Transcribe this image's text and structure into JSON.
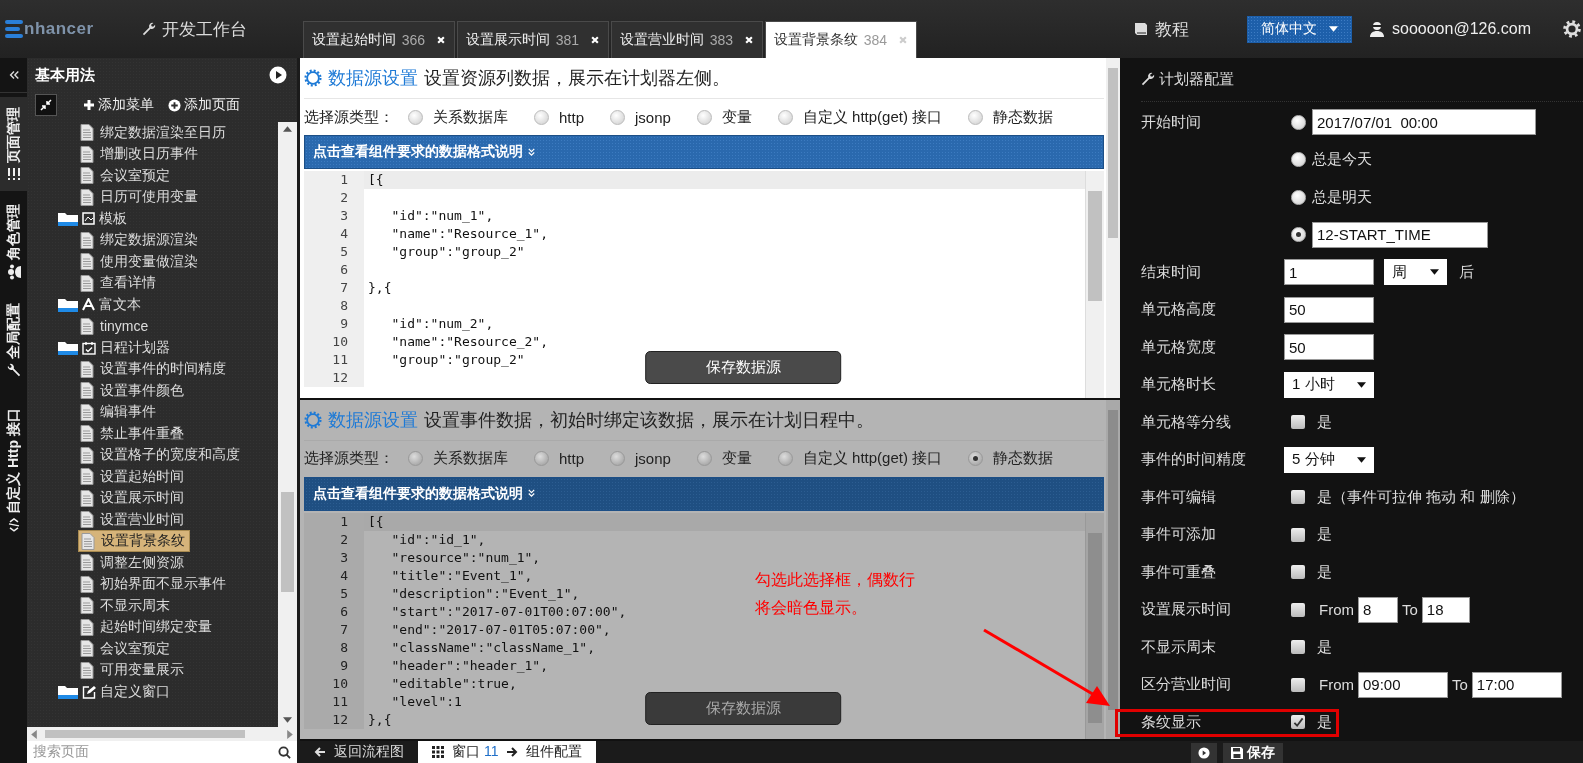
{
  "topbar": {
    "logo": "nhancer",
    "workbench": "开发工作台",
    "tabs": [
      {
        "label": "设置起始时间",
        "count": "366",
        "selected": false
      },
      {
        "label": "设置展示时间",
        "count": "381",
        "selected": false
      },
      {
        "label": "设置营业时间",
        "count": "383",
        "selected": false
      },
      {
        "label": "设置背景条纹",
        "count": "384",
        "selected": true
      }
    ],
    "tutorial": "教程",
    "language": "简体中文",
    "user": "sooooon@126.com"
  },
  "nav_tabs": [
    {
      "label": "页面管理",
      "selected": true
    },
    {
      "label": "角色管理",
      "selected": false
    },
    {
      "label": "全局配置",
      "selected": false
    },
    {
      "label": "自定义 Http 接口",
      "selected": false
    }
  ],
  "sidebar": {
    "title": "基本用法",
    "actions": [
      "添加菜单",
      "添加页面"
    ],
    "tree": [
      {
        "kind": "group",
        "children": [
          {
            "kind": "page",
            "label": "绑定数据渲染至日历",
            "selected": false
          },
          {
            "kind": "page",
            "label": "增删改日历事件",
            "selected": false
          },
          {
            "kind": "page",
            "label": "会议室预定",
            "selected": false
          },
          {
            "kind": "page",
            "label": "日历可使用变量",
            "selected": false
          }
        ]
      },
      {
        "kind": "folder",
        "label": "模板",
        "children": [
          {
            "kind": "page",
            "label": "绑定数据源渲染",
            "selected": false
          },
          {
            "kind": "page",
            "label": "使用变量做渲染",
            "selected": false
          },
          {
            "kind": "page",
            "label": "查看详情",
            "selected": false
          }
        ]
      },
      {
        "kind": "folder",
        "label": "富文本",
        "children": [
          {
            "kind": "page",
            "label": "tinymce",
            "selected": false
          }
        ]
      },
      {
        "kind": "folder",
        "label": "日程计划器",
        "children": [
          {
            "kind": "page",
            "label": "设置事件的时间精度",
            "selected": false
          },
          {
            "kind": "page",
            "label": "设置事件颜色",
            "selected": false
          },
          {
            "kind": "page",
            "label": "编辑事件",
            "selected": false
          },
          {
            "kind": "page",
            "label": "禁止事件重叠",
            "selected": false
          },
          {
            "kind": "page",
            "label": "设置格子的宽度和高度",
            "selected": false
          },
          {
            "kind": "page",
            "label": "设置起始时间",
            "selected": false
          },
          {
            "kind": "page",
            "label": "设置展示时间",
            "selected": false
          },
          {
            "kind": "page",
            "label": "设置营业时间",
            "selected": false
          },
          {
            "kind": "page",
            "label": "设置背景条纹",
            "selected": true
          },
          {
            "kind": "page",
            "label": "调整左侧资源",
            "selected": false
          },
          {
            "kind": "page",
            "label": "初始界面不显示事件",
            "selected": false
          },
          {
            "kind": "page",
            "label": "不显示周末",
            "selected": false
          },
          {
            "kind": "page",
            "label": "起始时间绑定变量",
            "selected": false
          },
          {
            "kind": "page",
            "label": "会议室预定",
            "selected": false
          },
          {
            "kind": "page",
            "label": "可用变量展示",
            "selected": false
          }
        ]
      },
      {
        "kind": "folder",
        "label": "自定义窗口"
      }
    ],
    "search": {
      "placeholder": "搜索页面"
    }
  },
  "panels": [
    {
      "heading": "数据源设置",
      "description": "设置资源列数据，展示在计划器左侧。",
      "dimmed": false,
      "source_label": "选择源类型：",
      "sources": [
        {
          "label": "关系数据库",
          "selected": false
        },
        {
          "label": "http",
          "selected": false
        },
        {
          "label": "jsonp",
          "selected": false
        },
        {
          "label": "变量",
          "selected": false
        },
        {
          "label": "自定义 http(get) 接口",
          "selected": false
        },
        {
          "label": "静态数据",
          "selected": false
        }
      ],
      "format_hint": "点击查看组件要求的数据格式说明",
      "code_lines": [
        {
          "number": "1",
          "code": "[{"
        },
        {
          "number": "2"
        },
        {
          "number": "3",
          "code": "   \"id\":\"num_1\","
        },
        {
          "number": "4",
          "code": "   \"name\":\"Resource_1\","
        },
        {
          "number": "5",
          "code": "   \"group\":\"group_2\""
        },
        {
          "number": "6"
        },
        {
          "number": "7",
          "code": "},{"
        },
        {
          "number": "8"
        },
        {
          "number": "9",
          "code": "   \"id\":\"num_2\","
        },
        {
          "number": "10",
          "code": "   \"name\":\"Resource_2\","
        },
        {
          "number": "11",
          "code": "   \"group\":\"group_2\""
        },
        {
          "number": "12"
        }
      ],
      "save": "保存数据源"
    },
    {
      "heading": "数据源设置",
      "description": "设置事件数据，初始时绑定该数据，展示在计划日程中。",
      "dimmed": true,
      "source_label": "选择源类型：",
      "sources": [
        {
          "label": "关系数据库",
          "selected": false
        },
        {
          "label": "http",
          "selected": false
        },
        {
          "label": "jsonp",
          "selected": false
        },
        {
          "label": "变量",
          "selected": false
        },
        {
          "label": "自定义 http(get) 接口",
          "selected": false
        },
        {
          "label": "静态数据",
          "selected": true
        }
      ],
      "format_hint": "点击查看组件要求的数据格式说明",
      "code_lines": [
        {
          "number": "1",
          "code": "[{"
        },
        {
          "number": "2",
          "code": "   \"id\":\"id_1\","
        },
        {
          "number": "3",
          "code": "   \"resource\":\"num_1\","
        },
        {
          "number": "4",
          "code": "   \"title\":\"Event_1\","
        },
        {
          "number": "5",
          "code": "   \"description\":\"Event_1\","
        },
        {
          "number": "6",
          "code": "   \"start\":\"2017-07-01T00:07:00\","
        },
        {
          "number": "7",
          "code": "   \"end\":\"2017-07-01T05:07:00\","
        },
        {
          "number": "8",
          "code": "   \"className\":\"className_1\","
        },
        {
          "number": "9",
          "code": "   \"header\":\"header_1\","
        },
        {
          "number": "10",
          "code": "   \"editable\":true,"
        },
        {
          "number": "11",
          "code": "   \"level\":1"
        },
        {
          "number": "12",
          "code": "},{"
        }
      ],
      "save": "保存数据源"
    }
  ],
  "annotation": {
    "text": "勾选此选择框，偶数行将会暗色显示。"
  },
  "config": {
    "title": "计划器配置",
    "rows": [
      {
        "kind": "start",
        "label": "开始时间",
        "highlighted": false,
        "options": [
          {
            "selected": false,
            "value": "2017/07/01  00:00"
          },
          {
            "selected": false,
            "text": "总是今天"
          },
          {
            "selected": false,
            "text": "总是明天"
          },
          {
            "selected": true,
            "value": "12-START_TIME"
          }
        ]
      },
      {
        "kind": "duration",
        "label": "结束时间",
        "highlighted": false,
        "value": "1",
        "unit": "周",
        "suffix": "后"
      },
      {
        "kind": "input",
        "label": "单元格高度",
        "highlighted": false,
        "value": "50"
      },
      {
        "kind": "input",
        "label": "单元格宽度",
        "highlighted": false,
        "value": "50"
      },
      {
        "kind": "select",
        "label": "单元格时长",
        "highlighted": false,
        "value": "1 小时"
      },
      {
        "kind": "checkbox",
        "label": "单元格等分线",
        "highlighted": false,
        "checked": false,
        "text": "是"
      },
      {
        "kind": "select",
        "label": "事件的时间精度",
        "highlighted": false,
        "value": "5 分钟"
      },
      {
        "kind": "checkbox",
        "label": "事件可编辑",
        "highlighted": false,
        "checked": false,
        "text": "是（事件可拉伸 拖动 和 删除）"
      },
      {
        "kind": "checkbox",
        "label": "事件可添加",
        "highlighted": false,
        "checked": false,
        "text": "是"
      },
      {
        "kind": "checkbox",
        "label": "事件可重叠",
        "highlighted": false,
        "checked": false,
        "text": "是"
      },
      {
        "kind": "range",
        "label": "设置展示时间",
        "highlighted": false,
        "checked": false,
        "from_label": "From",
        "from": "8",
        "to_label": "To",
        "to": "18"
      },
      {
        "kind": "checkbox",
        "label": "不显示周末",
        "highlighted": false,
        "checked": false,
        "text": "是"
      },
      {
        "kind": "range",
        "label": "区分营业时间",
        "highlighted": false,
        "checked": false,
        "from_label": "From",
        "from": "09:00",
        "to_label": "To",
        "to": "17:00"
      },
      {
        "kind": "checkbox",
        "label": "条纹显示",
        "highlighted": true,
        "checked": true,
        "text": "是"
      }
    ]
  },
  "bottombar": {
    "back": "返回流程图",
    "window_label": "窗口",
    "window_number": "11",
    "component": "组件配置",
    "save": "保存"
  }
}
